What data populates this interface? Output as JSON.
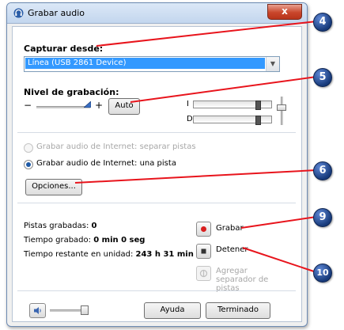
{
  "window": {
    "title": "Grabar audio",
    "close_symbol": "x"
  },
  "capture": {
    "label": "Capturar desde:",
    "selected_device": "Línea (USB 2861 Device)"
  },
  "level": {
    "label": "Nivel de grabación:",
    "minus": "−",
    "plus": "+",
    "auto_button": "Auto",
    "left_channel": "I",
    "right_channel": "D"
  },
  "options": {
    "radio_separate": "Grabar audio de Internet: separar pistas",
    "radio_single": "Grabar audio de Internet: una pista",
    "selected": "single",
    "options_button": "Opciones..."
  },
  "stats": {
    "tracks_label": "Pistas grabadas:",
    "tracks_value": "0",
    "time_label": "Tiempo grabado:",
    "time_value": "0 min 0 seg",
    "remaining_label": "Tiempo restante en unidad:",
    "remaining_value": "243 h 31 min"
  },
  "actions": {
    "record": "Grabar",
    "stop": "Detener",
    "add_separator": "Agregar separador de pistas"
  },
  "footer": {
    "help_button": "Ayuda",
    "done_button": "Terminado"
  },
  "callouts": [
    "4",
    "5",
    "6",
    "9",
    "10"
  ],
  "colors": {
    "callout": "#173a7a",
    "callout_line": "#e8141c",
    "selection": "#3399ff",
    "record": "#d81e1e"
  }
}
